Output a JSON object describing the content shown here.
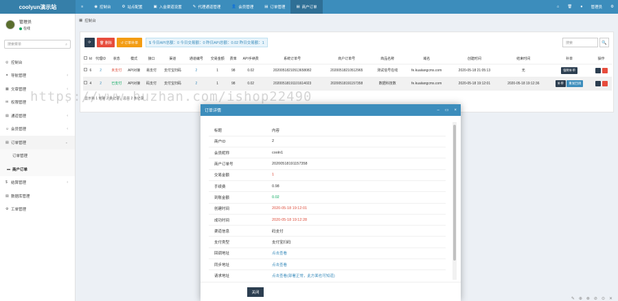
{
  "app": {
    "brand": "coolyun演示站"
  },
  "topnav": [
    {
      "icon": "≡",
      "label": ""
    },
    {
      "icon": "◉",
      "label": "控制台"
    },
    {
      "icon": "⚙",
      "label": "站点配置"
    },
    {
      "icon": "▣",
      "label": "入金渠道设置"
    },
    {
      "icon": "✎",
      "label": "代理通道管理"
    },
    {
      "icon": "👤",
      "label": "会员管理"
    },
    {
      "icon": "▤",
      "label": "订单管理"
    },
    {
      "icon": "▤",
      "label": "商户订单"
    }
  ],
  "topright": {
    "home": "⌂",
    "trash": "🗑",
    "user_icon": "●",
    "user": "管理员",
    "settings": "⚙"
  },
  "sidebar": {
    "username": "管理员",
    "status": "在线",
    "search_placeholder": "搜索菜单",
    "items": [
      {
        "icon": "◎",
        "label": "控制台",
        "chev": ""
      },
      {
        "icon": "✦",
        "label": "导航管理",
        "chev": "‹"
      },
      {
        "icon": "▦",
        "label": "文章管理",
        "chev": "‹"
      },
      {
        "icon": "✉",
        "label": "权限管理",
        "chev": "‹"
      },
      {
        "icon": "▤",
        "label": "通道管理",
        "chev": "‹"
      },
      {
        "icon": "☺",
        "label": "会员管理",
        "chev": "‹"
      },
      {
        "icon": "▤",
        "label": "订单管理",
        "chev": "⌄"
      },
      {
        "icon": "",
        "label": "订单管理",
        "chev": ""
      },
      {
        "icon": "▬",
        "label": "商户订单",
        "chev": ""
      },
      {
        "icon": "$",
        "label": "结算管理",
        "chev": "‹"
      },
      {
        "icon": "▤",
        "label": "数据库管理",
        "chev": ""
      },
      {
        "icon": "⚙",
        "label": "工单管理",
        "chev": ""
      }
    ]
  },
  "breadcrumb": {
    "icon": "▦",
    "label": "控制台"
  },
  "toolbar": {
    "refresh": "⟳",
    "delete": "🗑 删除",
    "repay": "↺ 订单补单",
    "stats": "$ 今日API总额：0 今日交易额：0 昨日API总额：0.02 昨日交易额：1"
  },
  "panel_search": {
    "placeholder": "搜索",
    "icon": "🔍"
  },
  "table": {
    "headers": [
      "",
      "Id",
      "代理ID",
      "状态",
      "模式",
      "接口",
      "渠道",
      "通道编号",
      "交易金额",
      "费率",
      "API手续费",
      "系统订单号",
      "商户订单号",
      "商品名称",
      "域名",
      "创建时间",
      "结束时间",
      "补单",
      "操作"
    ],
    "rows": [
      {
        "id": "6",
        "agent": "2",
        "status": "未支付",
        "mode": "API对接",
        "iface": "易支付",
        "channel": "支付宝扫码",
        "chno": "2",
        "amount": "1",
        "rate": "98",
        "fee": "0.02",
        "sysno": "20200518210513658082",
        "merno": "20200518210512965",
        "goods": "测试信号在线",
        "domain": "fe.kuaiiangcms.com",
        "created": "2020-05-18 21:05:13",
        "ended": "无",
        "repay": "强制补单",
        "repay2": ""
      },
      {
        "id": "4",
        "agent": "2",
        "status": "已支付",
        "mode": "API对接",
        "iface": "码支付",
        "channel": "支付宝扫码",
        "chno": "2",
        "amount": "1",
        "rate": "98",
        "fee": "0.02",
        "sysno": "20200518191101614023",
        "merno": "20200518191157358",
        "goods": "数据科技数",
        "domain": "fe.kuaiiangcms.com",
        "created": "2020-05-18 19:12:01",
        "ended": "2020-05-18 19:12:36",
        "repay": "补单",
        "repay2": "重发回调"
      }
    ]
  },
  "pager": "显示第 1 到第 2 条记录，总共 2 条记录",
  "modal": {
    "title": "订单详情",
    "controls": {
      "min": "–",
      "max": "▭",
      "close": "×"
    },
    "rows": [
      {
        "k": "标题",
        "v": "内容",
        "cls": ""
      },
      {
        "k": "商户ID",
        "v": "2",
        "cls": ""
      },
      {
        "k": "会员昵称",
        "v": "cooln1",
        "cls": ""
      },
      {
        "k": "商户订单号",
        "v": "20200518191157358",
        "cls": ""
      },
      {
        "k": "交易金额",
        "v": "1",
        "cls": "red"
      },
      {
        "k": "手续费",
        "v": "0.98",
        "cls": ""
      },
      {
        "k": "到账金额",
        "v": "0.02",
        "cls": "green"
      },
      {
        "k": "创建时间",
        "v": "2020-05-18 19:12:01",
        "cls": "red"
      },
      {
        "k": "成功时间",
        "v": "2020-05-18 19:12:28",
        "cls": "red"
      },
      {
        "k": "渠道信息",
        "v": "码支付",
        "cls": ""
      },
      {
        "k": "支付类型",
        "v": "支付宝扫码",
        "cls": ""
      },
      {
        "k": "回调地址",
        "v": "点击查看",
        "cls": "blue"
      },
      {
        "k": "同步地址",
        "v": "点击查看",
        "cls": "blue"
      },
      {
        "k": "请求地址",
        "v": "点击查看(部署正常，此方面也可知道)",
        "cls": "blue"
      }
    ],
    "close_label": "关闭"
  },
  "watermark": "https://www.huzhan.com/ishop22490",
  "bottom_icons": [
    "✎",
    "⊕",
    "⊗",
    "⊘",
    "⊙",
    "✕"
  ]
}
